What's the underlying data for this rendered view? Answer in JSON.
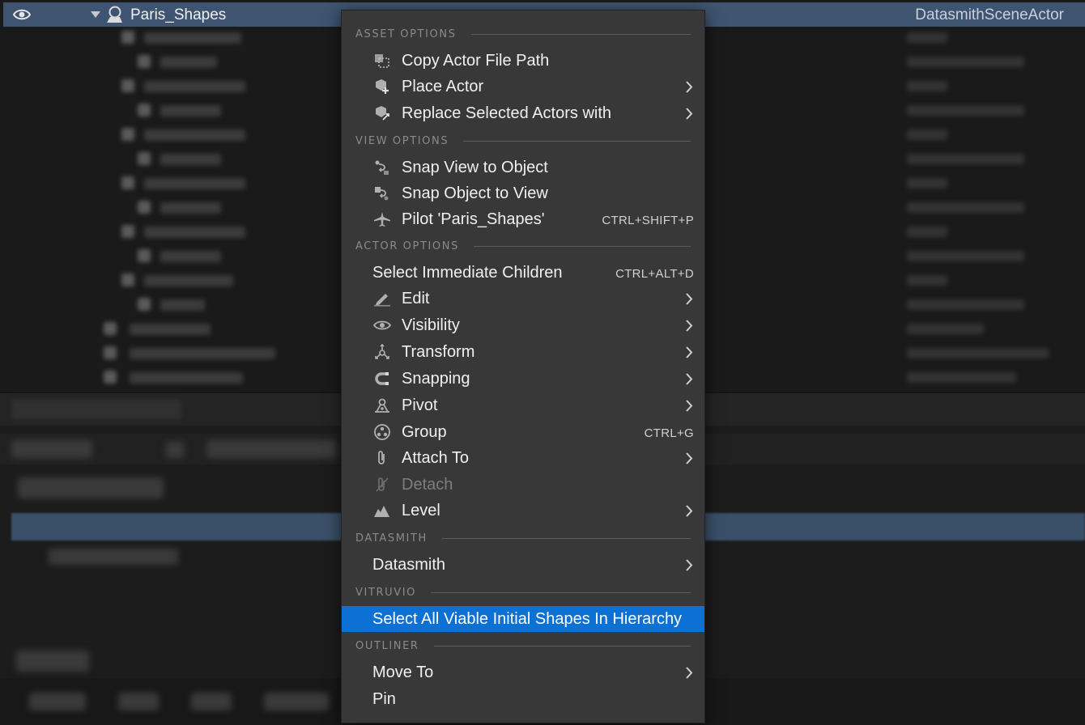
{
  "outliner": {
    "selected_actor": {
      "name": "Paris_Shapes",
      "type": "DatasmithSceneActor",
      "icons": [
        "eye-icon",
        "expand-arrow-icon",
        "actor-icon"
      ]
    }
  },
  "context_menu": {
    "sections": [
      {
        "header": "ASSET OPTIONS",
        "items": [
          {
            "label": "Copy Actor File Path",
            "icon": "copy-path-icon",
            "submenu": false,
            "shortcut": ""
          },
          {
            "label": "Place Actor",
            "icon": "place-actor-icon",
            "submenu": true,
            "shortcut": ""
          },
          {
            "label": "Replace Selected Actors with",
            "icon": "replace-actor-icon",
            "submenu": true,
            "shortcut": ""
          }
        ]
      },
      {
        "header": "VIEW OPTIONS",
        "items": [
          {
            "label": "Snap View to Object",
            "icon": "snap-view-icon",
            "submenu": false,
            "shortcut": ""
          },
          {
            "label": "Snap Object to View",
            "icon": "snap-object-icon",
            "submenu": false,
            "shortcut": ""
          },
          {
            "label": "Pilot 'Paris_Shapes'",
            "icon": "pilot-icon",
            "submenu": false,
            "shortcut": "CTRL+SHIFT+P"
          }
        ]
      },
      {
        "header": "ACTOR OPTIONS",
        "items": [
          {
            "label": "Select Immediate Children",
            "icon": "",
            "submenu": false,
            "shortcut": "CTRL+ALT+D"
          },
          {
            "label": "Edit",
            "icon": "pencil-icon",
            "submenu": true,
            "shortcut": ""
          },
          {
            "label": "Visibility",
            "icon": "eye-icon",
            "submenu": true,
            "shortcut": ""
          },
          {
            "label": "Transform",
            "icon": "transform-icon",
            "submenu": true,
            "shortcut": ""
          },
          {
            "label": "Snapping",
            "icon": "magnet-icon",
            "submenu": true,
            "shortcut": ""
          },
          {
            "label": "Pivot",
            "icon": "pivot-icon",
            "submenu": true,
            "shortcut": ""
          },
          {
            "label": "Group",
            "icon": "group-icon",
            "submenu": false,
            "shortcut": "CTRL+G"
          },
          {
            "label": "Attach To",
            "icon": "paperclip-icon",
            "submenu": true,
            "shortcut": ""
          },
          {
            "label": "Detach",
            "icon": "detach-icon",
            "submenu": false,
            "shortcut": "",
            "disabled": true
          },
          {
            "label": "Level",
            "icon": "level-icon",
            "submenu": true,
            "shortcut": ""
          }
        ]
      },
      {
        "header": "DATASMITH",
        "items": [
          {
            "label": "Datasmith",
            "icon": "",
            "submenu": true,
            "shortcut": ""
          }
        ]
      },
      {
        "header": "VITRUVIO",
        "items": [
          {
            "label": "Select All Viable Initial Shapes In Hierarchy",
            "icon": "",
            "submenu": false,
            "shortcut": "",
            "highlighted": true
          }
        ]
      },
      {
        "header": "OUTLINER",
        "items": [
          {
            "label": "Move To",
            "icon": "",
            "submenu": true,
            "shortcut": ""
          },
          {
            "label": "Pin",
            "icon": "",
            "submenu": false,
            "shortcut": ""
          }
        ]
      }
    ]
  },
  "colors": {
    "menu_bg": "#383838",
    "highlight": "#0d70d4",
    "selected_row": "#3e5470",
    "section_text": "#8a8a8a"
  }
}
